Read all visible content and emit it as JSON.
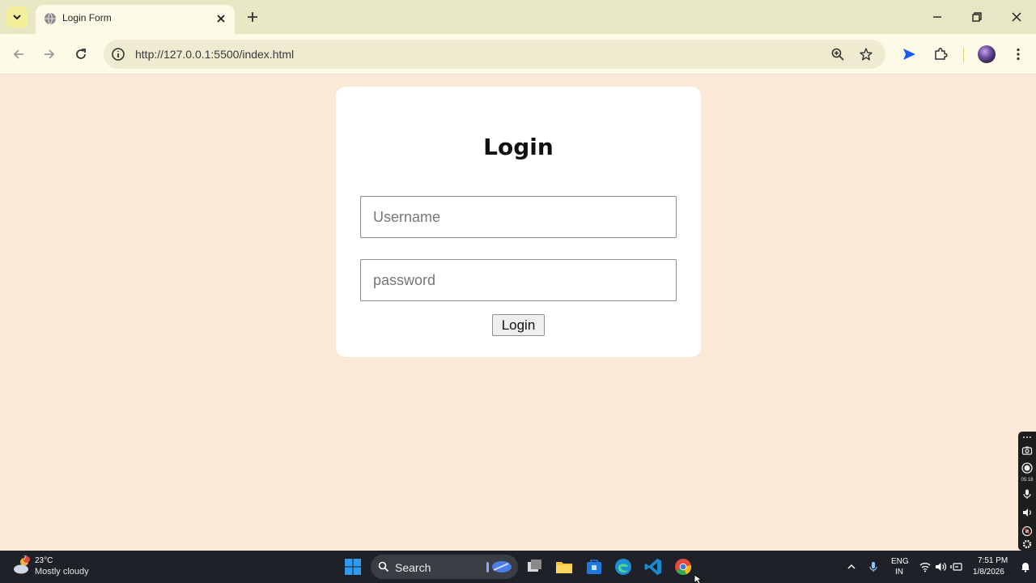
{
  "browser": {
    "tab_title": "Login Form",
    "url": "http://127.0.0.1:5500/index.html"
  },
  "page": {
    "heading": "Login",
    "username_placeholder": "Username",
    "username_value": "",
    "password_placeholder": "password",
    "password_value": "",
    "login_button": "Login"
  },
  "recorder": {
    "elapsed": "05:18"
  },
  "taskbar": {
    "weather_temp": "23°C",
    "weather_desc": "Mostly cloudy",
    "weather_badge": "7",
    "search_label": "Search",
    "lang_line1": "ENG",
    "lang_line2": "IN",
    "time": "7:51 PM",
    "date": "1/8/2026"
  },
  "colors": {
    "page_background": "#fae9d7",
    "card_background": "#ffffff",
    "browser_chrome": "#fdfbe8",
    "tab_strip": "#e7e7c4",
    "taskbar": "#1e2128"
  }
}
